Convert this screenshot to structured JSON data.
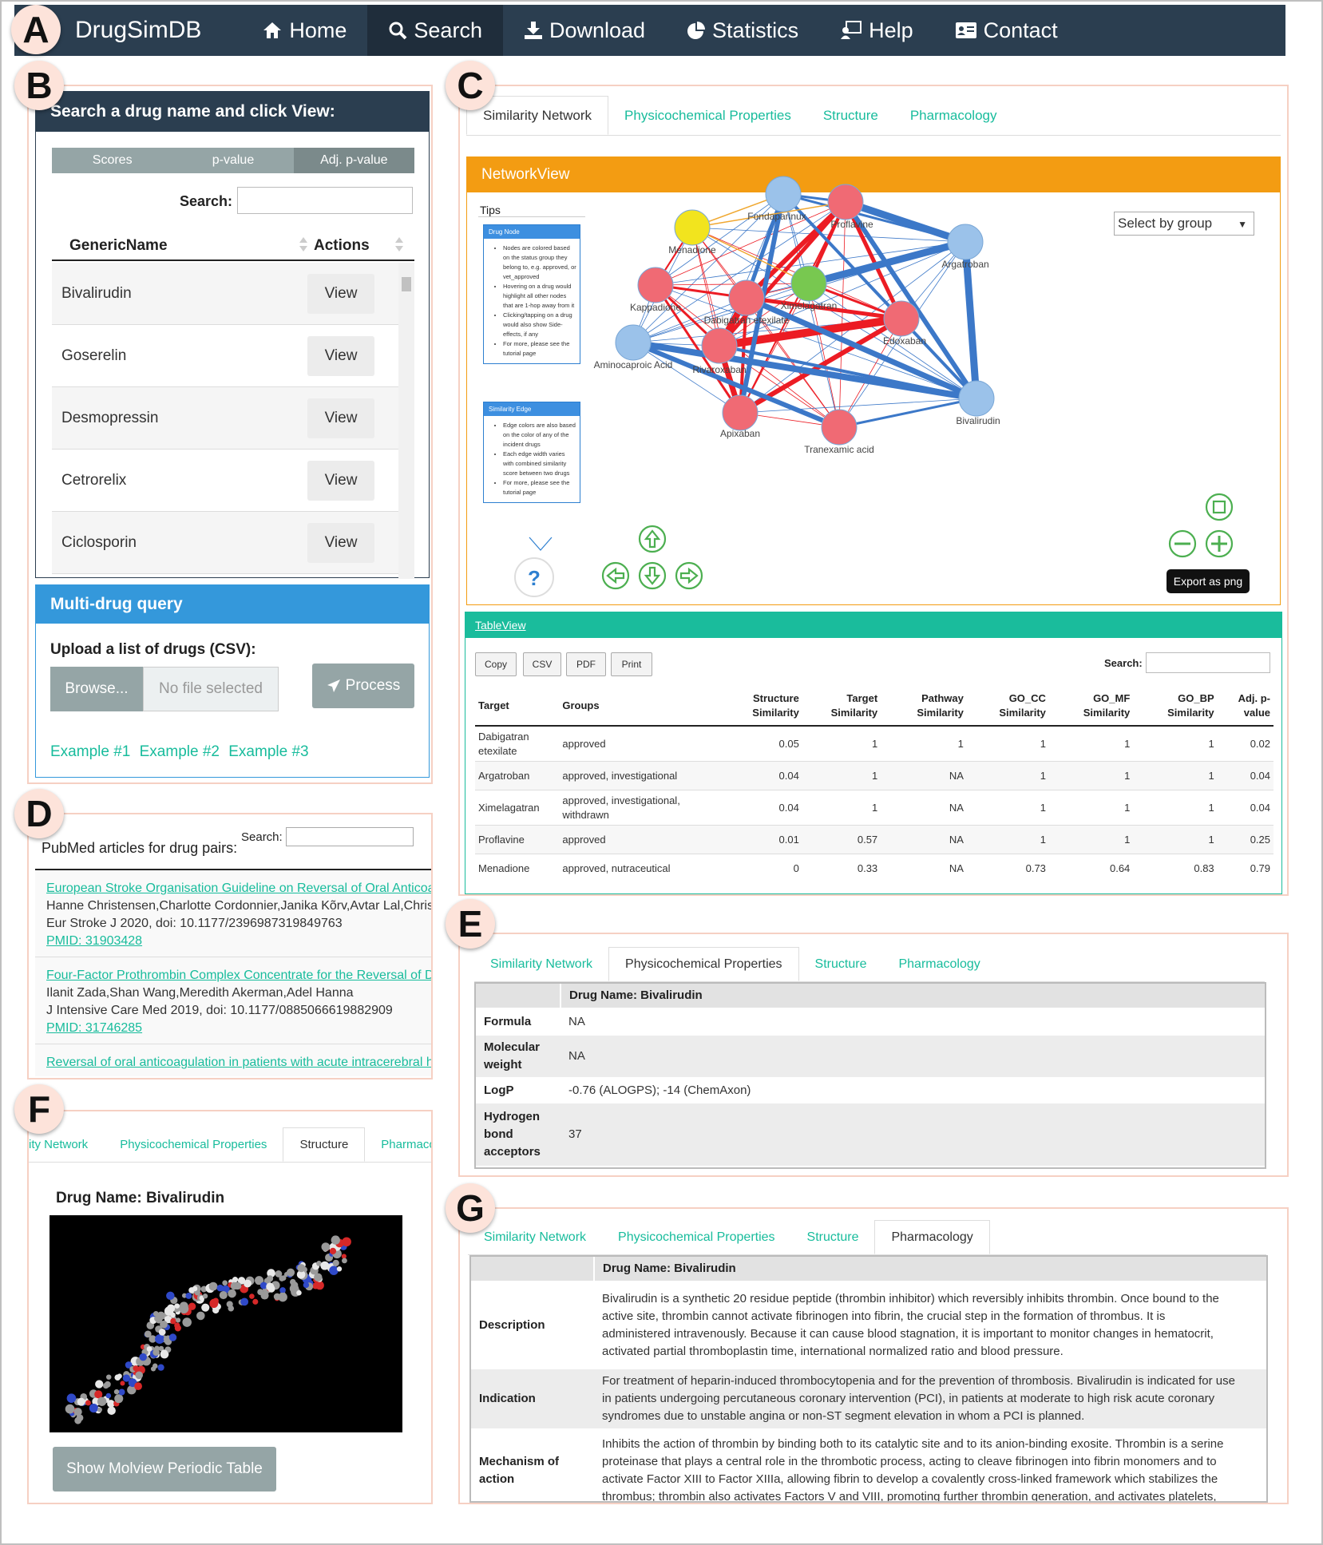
{
  "panel_letters": [
    "A",
    "B",
    "C",
    "D",
    "E",
    "F",
    "G"
  ],
  "navbar": {
    "brand": "DrugSimDB",
    "items": [
      {
        "label": "Home",
        "icon": "home-icon"
      },
      {
        "label": "Search",
        "icon": "search-icon",
        "active": true
      },
      {
        "label": "Download",
        "icon": "download-icon"
      },
      {
        "label": "Statistics",
        "icon": "pie-chart-icon"
      },
      {
        "label": "Help",
        "icon": "help-icon"
      },
      {
        "label": "Contact",
        "icon": "contact-card-icon"
      }
    ]
  },
  "search_panel": {
    "title": "Search a drug name and click View:",
    "segments": [
      "Scores",
      "p-value",
      "Adj. p-value"
    ],
    "search_label": "Search:",
    "columns": [
      "GenericName",
      "Actions"
    ],
    "view_label": "View",
    "drugs": [
      "Bivalirudin",
      "Goserelin",
      "Desmopressin",
      "Cetrorelix",
      "Ciclosporin"
    ]
  },
  "multi_drug": {
    "title": "Multi-drug query",
    "upload_label": "Upload a list of drugs (CSV):",
    "browse_label": "Browse...",
    "no_file_label": "No file selected",
    "process_label": "Process",
    "examples": [
      "Example #1",
      "Example #2",
      "Example #3"
    ]
  },
  "tabs": [
    "Similarity Network",
    "Physicochemical Properties",
    "Structure",
    "Pharmacology"
  ],
  "tabs_f_visible": [
    "ity Network",
    "Physicochemical Properties",
    "Structure",
    "Pharmacolo"
  ],
  "network_view": {
    "title": "NetworkView",
    "tips_label": "Tips",
    "drug_node_title": "Drug Node",
    "drug_node_tips": [
      "Nodes are colored based on the status group they belong to, e.g. approved, or vet_approved",
      "Hovering on a drug would highlight all other nodes that are 1-hop away from it",
      "Clicking/tapping on a drug would also show Side-effects, if any",
      "For more, please see the tutorial page"
    ],
    "edge_title": "Similarity Edge",
    "edge_tips": [
      "Edge colors are also based on the color of any of the incident drugs",
      "Each edge width varies with combined similarity score between two drugs",
      "For more, please see the tutorial page"
    ],
    "help_symbol": "?",
    "select_label": "Select by group",
    "export_label": "Export as png",
    "node_colors": {
      "approved": "#f06a74",
      "investigational": "#9bc2ea",
      "nutraceutical": "#f2e41e",
      "query": "#78c850"
    },
    "edge_colors": {
      "red": "#ec1c24",
      "blue": "#3c78c8",
      "orange": "#f0a830"
    },
    "nodes": [
      {
        "label": "Fondaparinux",
        "group": "investigational"
      },
      {
        "label": "Proflavine",
        "group": "approved"
      },
      {
        "label": "Menadione",
        "group": "nutraceutical"
      },
      {
        "label": "Argatroban",
        "group": "investigational"
      },
      {
        "label": "Kappadione",
        "group": "approved"
      },
      {
        "label": "Ximelagatran",
        "group": "query"
      },
      {
        "label": "Dabigatran etexilate",
        "group": "approved"
      },
      {
        "label": "Edoxaban",
        "group": "approved"
      },
      {
        "label": "Aminocaproic Acid",
        "group": "investigational"
      },
      {
        "label": "Rivaroxaban",
        "group": "approved"
      },
      {
        "label": "Bivalirudin",
        "group": "investigational"
      },
      {
        "label": "Apixaban",
        "group": "approved"
      },
      {
        "label": "Tranexamic acid",
        "group": "approved"
      }
    ]
  },
  "table_view": {
    "title": "TableView",
    "buttons": [
      "Copy",
      "CSV",
      "PDF",
      "Print"
    ],
    "search_label": "Search:",
    "headers": [
      [
        "Target"
      ],
      [
        "Groups"
      ],
      [
        "Structure",
        "Similarity"
      ],
      [
        "Target",
        "Similarity"
      ],
      [
        "Pathway",
        "Similarity"
      ],
      [
        "GO_CC",
        "Similarity"
      ],
      [
        "GO_MF",
        "Similarity"
      ],
      [
        "GO_BP",
        "Similarity"
      ],
      [
        "Adj. p-",
        "value"
      ]
    ],
    "rows": [
      [
        [
          "Dabigatran",
          "etexilate"
        ],
        [
          "approved"
        ],
        "0.05",
        "1",
        "1",
        "1",
        "1",
        "1",
        "0.02"
      ],
      [
        [
          "Argatroban"
        ],
        [
          "approved, investigational"
        ],
        "0.04",
        "1",
        "NA",
        "1",
        "1",
        "1",
        "0.04"
      ],
      [
        [
          "Ximelagatran"
        ],
        [
          "approved, investigational,",
          "withdrawn"
        ],
        "0.04",
        "1",
        "NA",
        "1",
        "1",
        "1",
        "0.04"
      ],
      [
        [
          "Proflavine"
        ],
        [
          "approved"
        ],
        "0.01",
        "0.57",
        "NA",
        "1",
        "1",
        "1",
        "0.25"
      ],
      [
        [
          "Menadione"
        ],
        [
          "approved, nutraceutical"
        ],
        "0",
        "0.33",
        "NA",
        "0.73",
        "0.64",
        "0.83",
        "0.79"
      ]
    ]
  },
  "pubmed": {
    "title": "PubMed articles for drug pairs:",
    "search_label": "Search:",
    "articles": [
      {
        "title": "European Stroke Organisation Guideline on Reversal of Oral Anticoag",
        "authors": "Hanne Christensen,Charlotte Cordonnier,Janika Kõrv,Avtar Lal,Christ",
        "journal": "Eur Stroke J 2020, doi: 10.1177/2396987319849763",
        "pmid": "PMID: 31903428"
      },
      {
        "title": "Four-Factor Prothrombin Complex Concentrate for the Reversal of Di",
        "authors": "Ilanit Zada,Shan Wang,Meredith Akerman,Adel Hanna",
        "journal": "J Intensive Care Med 2019, doi: 10.1177/0885066619882909",
        "pmid": "PMID: 31746285"
      },
      {
        "title": "Reversal of oral anticoagulation in patients with acute intracerebral he",
        "authors": "",
        "journal": "",
        "pmid": ""
      }
    ]
  },
  "physchem": {
    "drug_name": "Drug Name: Bivalirudin",
    "rows": [
      {
        "key": [
          "Formula"
        ],
        "value": "NA"
      },
      {
        "key": [
          "Molecular",
          "weight"
        ],
        "value": "NA"
      },
      {
        "key": [
          "LogP"
        ],
        "value": "-0.76 (ALOGPS); -14 (ChemAxon)"
      },
      {
        "key": [
          "Hydrogen",
          "bond",
          "acceptors"
        ],
        "value": "37"
      }
    ]
  },
  "structure": {
    "drug_name": "Drug Name: Bivalirudin",
    "molview_button": "Show Molview Periodic Table"
  },
  "pharmacology": {
    "drug_name": "Drug Name: Bivalirudin",
    "rows": [
      {
        "key": [
          "Description"
        ],
        "lines": [
          "Bivalirudin is a synthetic 20 residue peptide (thrombin inhibitor) which reversibly inhibits thrombin. Once bound to the",
          "active site, thrombin cannot activate fibrinogen into fibrin, the crucial step in the formation of thrombus. It is",
          "administered intravenously. Because it can cause blood stagnation, it is important to monitor changes in hematocrit,",
          "activated partial thromboplastin time, international normalized ratio and blood pressure."
        ]
      },
      {
        "key": [
          "Indication"
        ],
        "lines": [
          "For treatment of heparin-induced thrombocytopenia and for the prevention of thrombosis. Bivalirudin is indicated for use",
          "in patients undergoing percutaneous coronary intervention (PCI), in patients at moderate to high risk acute coronary",
          "syndromes due to unstable angina or non-ST segment elevation in whom a PCI is planned."
        ]
      },
      {
        "key": [
          "Mechanism of",
          "action"
        ],
        "lines": [
          "Inhibits the action of thrombin by binding both to its catalytic site and to its anion-binding exosite. Thrombin is a serine",
          "proteinase that plays a central role in the thrombotic process, acting to cleave fibrinogen into fibrin monomers and to",
          "activate Factor XIII to Factor XIIIa, allowing fibrin to develop a covalently cross-linked framework which stabilizes the",
          "thrombus; thrombin also activates Factors V and VIII, promoting further thrombin generation, and activates platelets,"
        ]
      }
    ]
  }
}
